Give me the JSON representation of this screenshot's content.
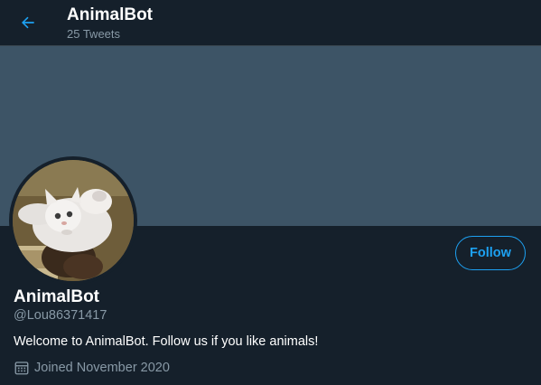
{
  "header": {
    "title": "AnimalBot",
    "tweet_count": "25 Tweets",
    "back_icon": "arrow-left-icon"
  },
  "profile": {
    "display_name": "AnimalBot",
    "handle": "@Lou86371417",
    "bio": "Welcome to AnimalBot. Follow us if you like animals!",
    "joined": "Joined November 2020",
    "joined_icon": "calendar-icon",
    "follow_label": "Follow"
  },
  "colors": {
    "background": "#15202b",
    "banner": "#3d5466",
    "accent": "#1da1f2",
    "secondary_text": "#8899a6"
  }
}
